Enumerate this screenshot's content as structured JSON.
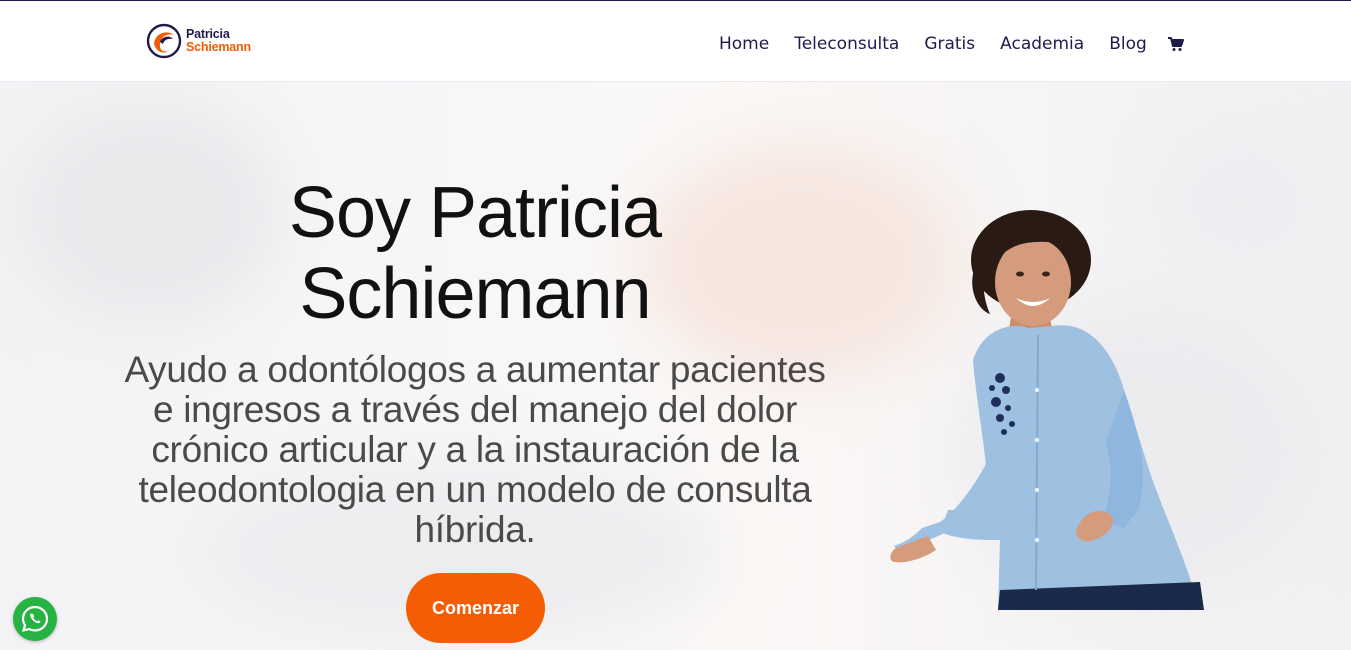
{
  "header": {
    "logo": {
      "line1": "Patricia",
      "line2": "Schiemann"
    },
    "nav": [
      {
        "label": "Home"
      },
      {
        "label": "Teleconsulta"
      },
      {
        "label": "Gratis"
      },
      {
        "label": "Academia"
      },
      {
        "label": "Blog"
      }
    ],
    "cart_icon": "shopping-cart-icon"
  },
  "hero": {
    "title_line1": "Soy Patricia",
    "title_line2": "Schiemann",
    "subtitle": "Ayudo a odontólogos a aumentar pacientes e ingresos a través del manejo del dolor crónico articular y a la instauración de la teleodontologia en un modelo de consulta híbrida.",
    "cta_label": "Comenzar"
  },
  "floating": {
    "whatsapp_icon": "whatsapp-icon"
  },
  "colors": {
    "brand_navy": "#1f1b4d",
    "brand_orange": "#f45d03",
    "whatsapp_green": "#26b341",
    "shirt_blue": "#9ec1e2"
  }
}
